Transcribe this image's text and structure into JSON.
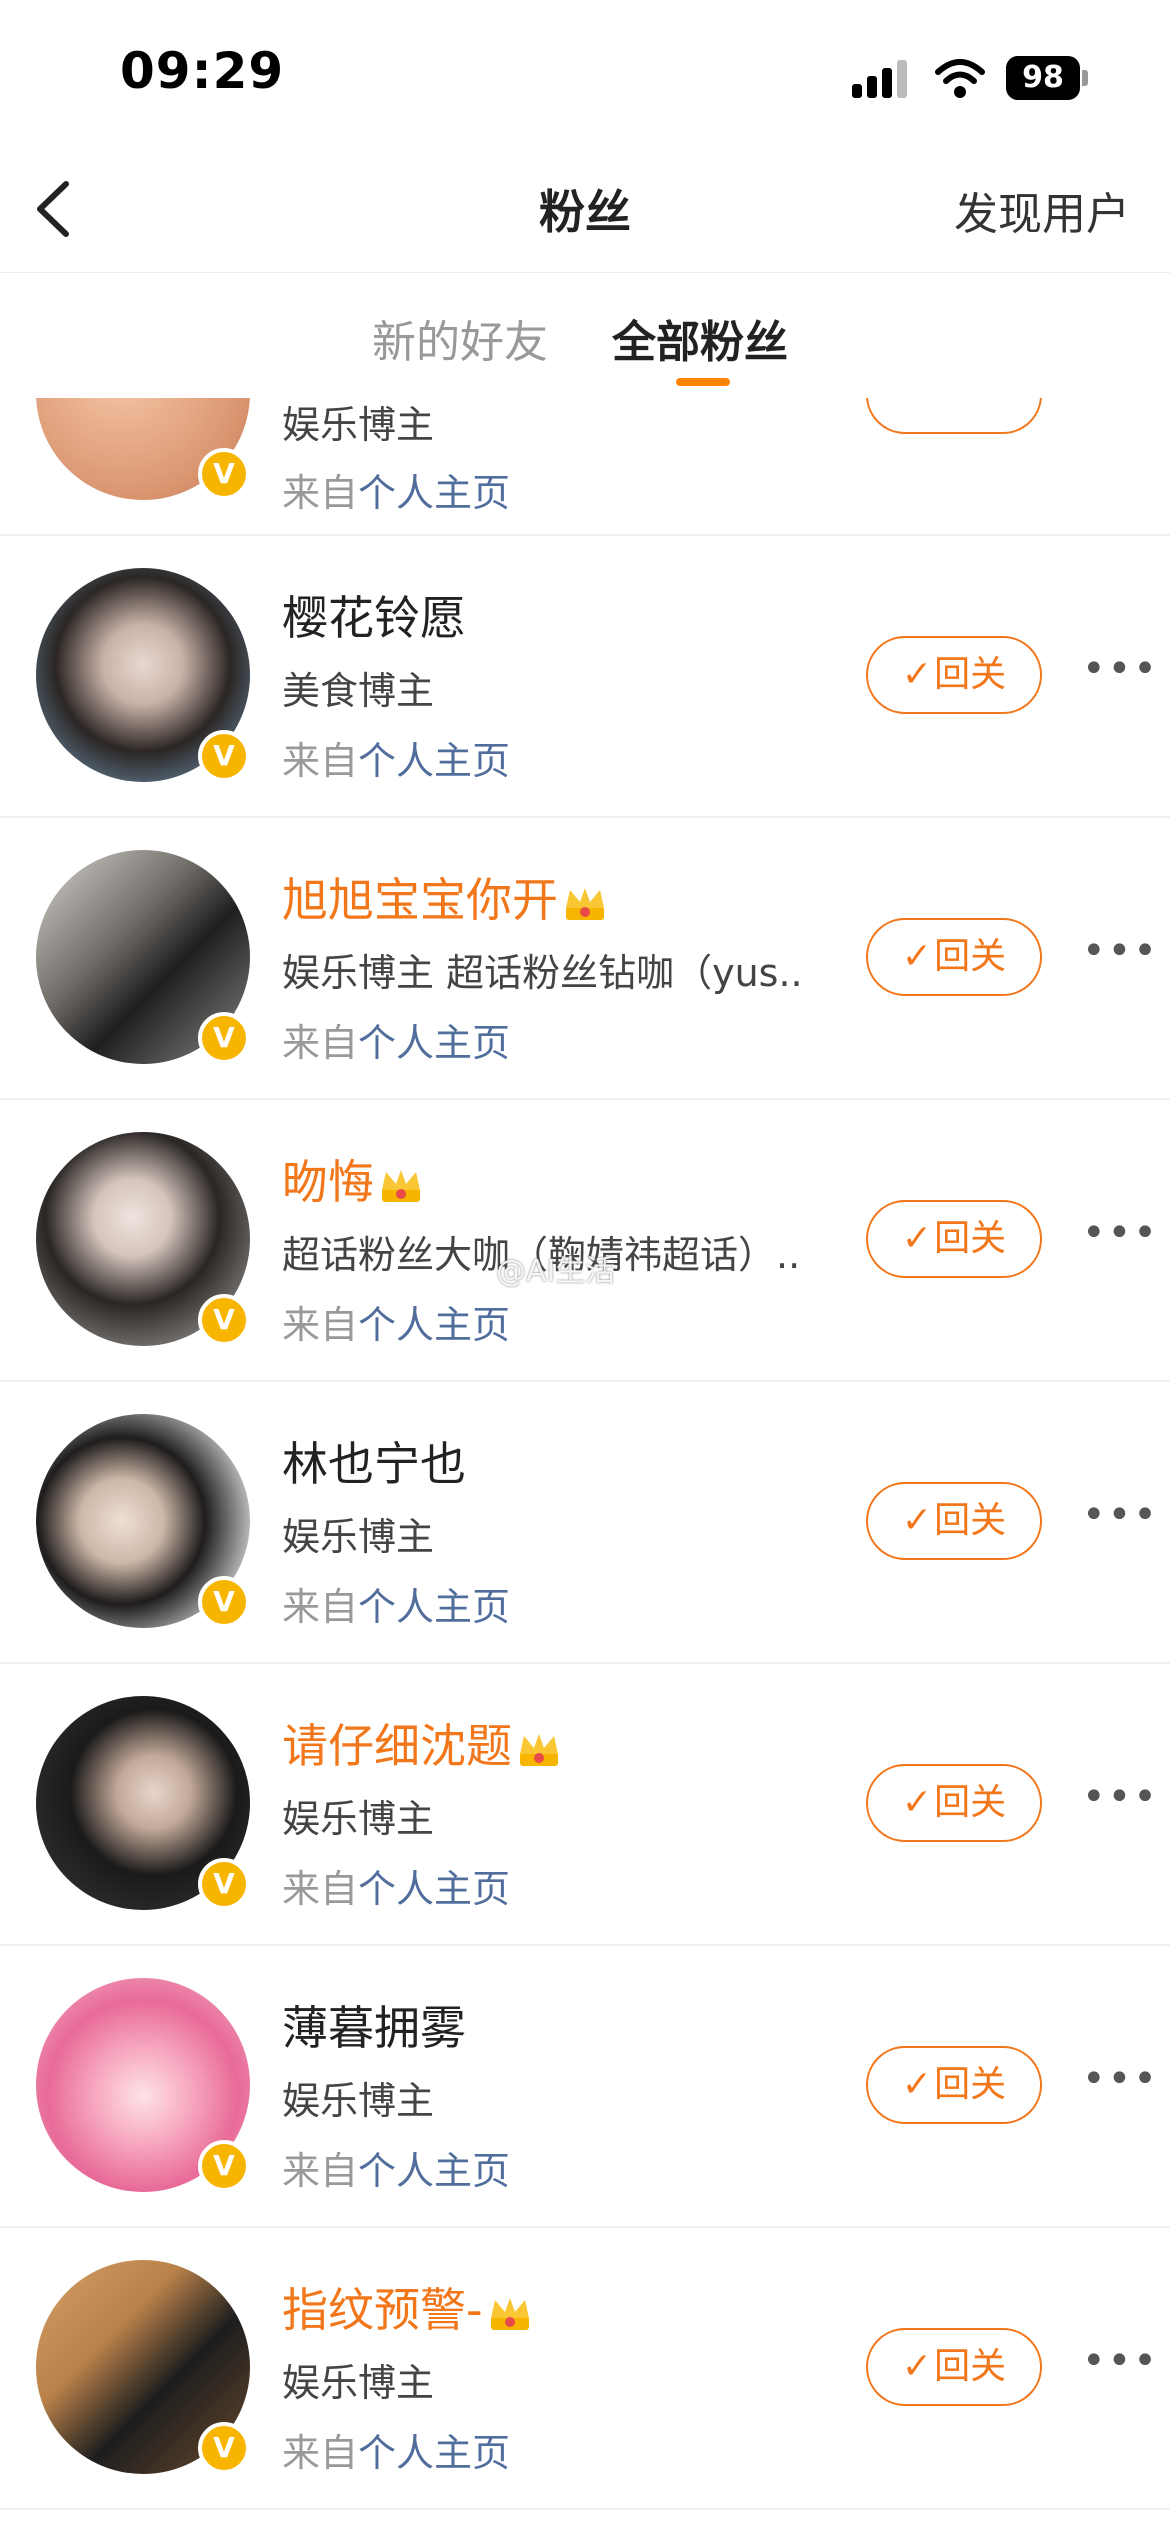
{
  "status_bar": {
    "time": "09:29",
    "battery": "98"
  },
  "nav": {
    "title": "粉丝",
    "right_label": "发现用户"
  },
  "tabs": [
    {
      "label": "新的好友"
    },
    {
      "label": "全部粉丝"
    }
  ],
  "list": {
    "partial_row": {
      "desc": "娱乐博主",
      "source_prefix": "来自",
      "source_link": "个人主页"
    },
    "rows": [
      {
        "name": "樱花铃愿",
        "vip": false,
        "desc": "美食博主",
        "source_prefix": "来自",
        "source_link": "个人主页",
        "follow_label": "回关"
      },
      {
        "name": "旭旭宝宝你开",
        "vip": true,
        "desc": "娱乐博主 超话粉丝钻咖（yus...",
        "source_prefix": "来自",
        "source_link": "个人主页",
        "follow_label": "回关"
      },
      {
        "name": "昒悔",
        "vip": true,
        "desc": "超话粉丝大咖（鞠婧祎超话）...",
        "source_prefix": "来自",
        "source_link": "个人主页",
        "follow_label": "回关"
      },
      {
        "name": "林也宁也",
        "vip": false,
        "desc": "娱乐博主",
        "source_prefix": "来自",
        "source_link": "个人主页",
        "follow_label": "回关"
      },
      {
        "name": "请仔细沈题",
        "vip": true,
        "desc": "娱乐博主",
        "source_prefix": "来自",
        "source_link": "个人主页",
        "follow_label": "回关"
      },
      {
        "name": "薄暮拥雾",
        "vip": false,
        "desc": "娱乐博主",
        "source_prefix": "来自",
        "source_link": "个人主页",
        "follow_label": "回关"
      },
      {
        "name": "指纹预警-",
        "vip": true,
        "desc": "娱乐博主",
        "source_prefix": "来自",
        "source_link": "个人主页",
        "follow_label": "回关"
      }
    ]
  },
  "watermark": "@AI生活",
  "colors": {
    "accent": "#f2761a",
    "link": "#506d9c",
    "badge": "#f7b500"
  }
}
